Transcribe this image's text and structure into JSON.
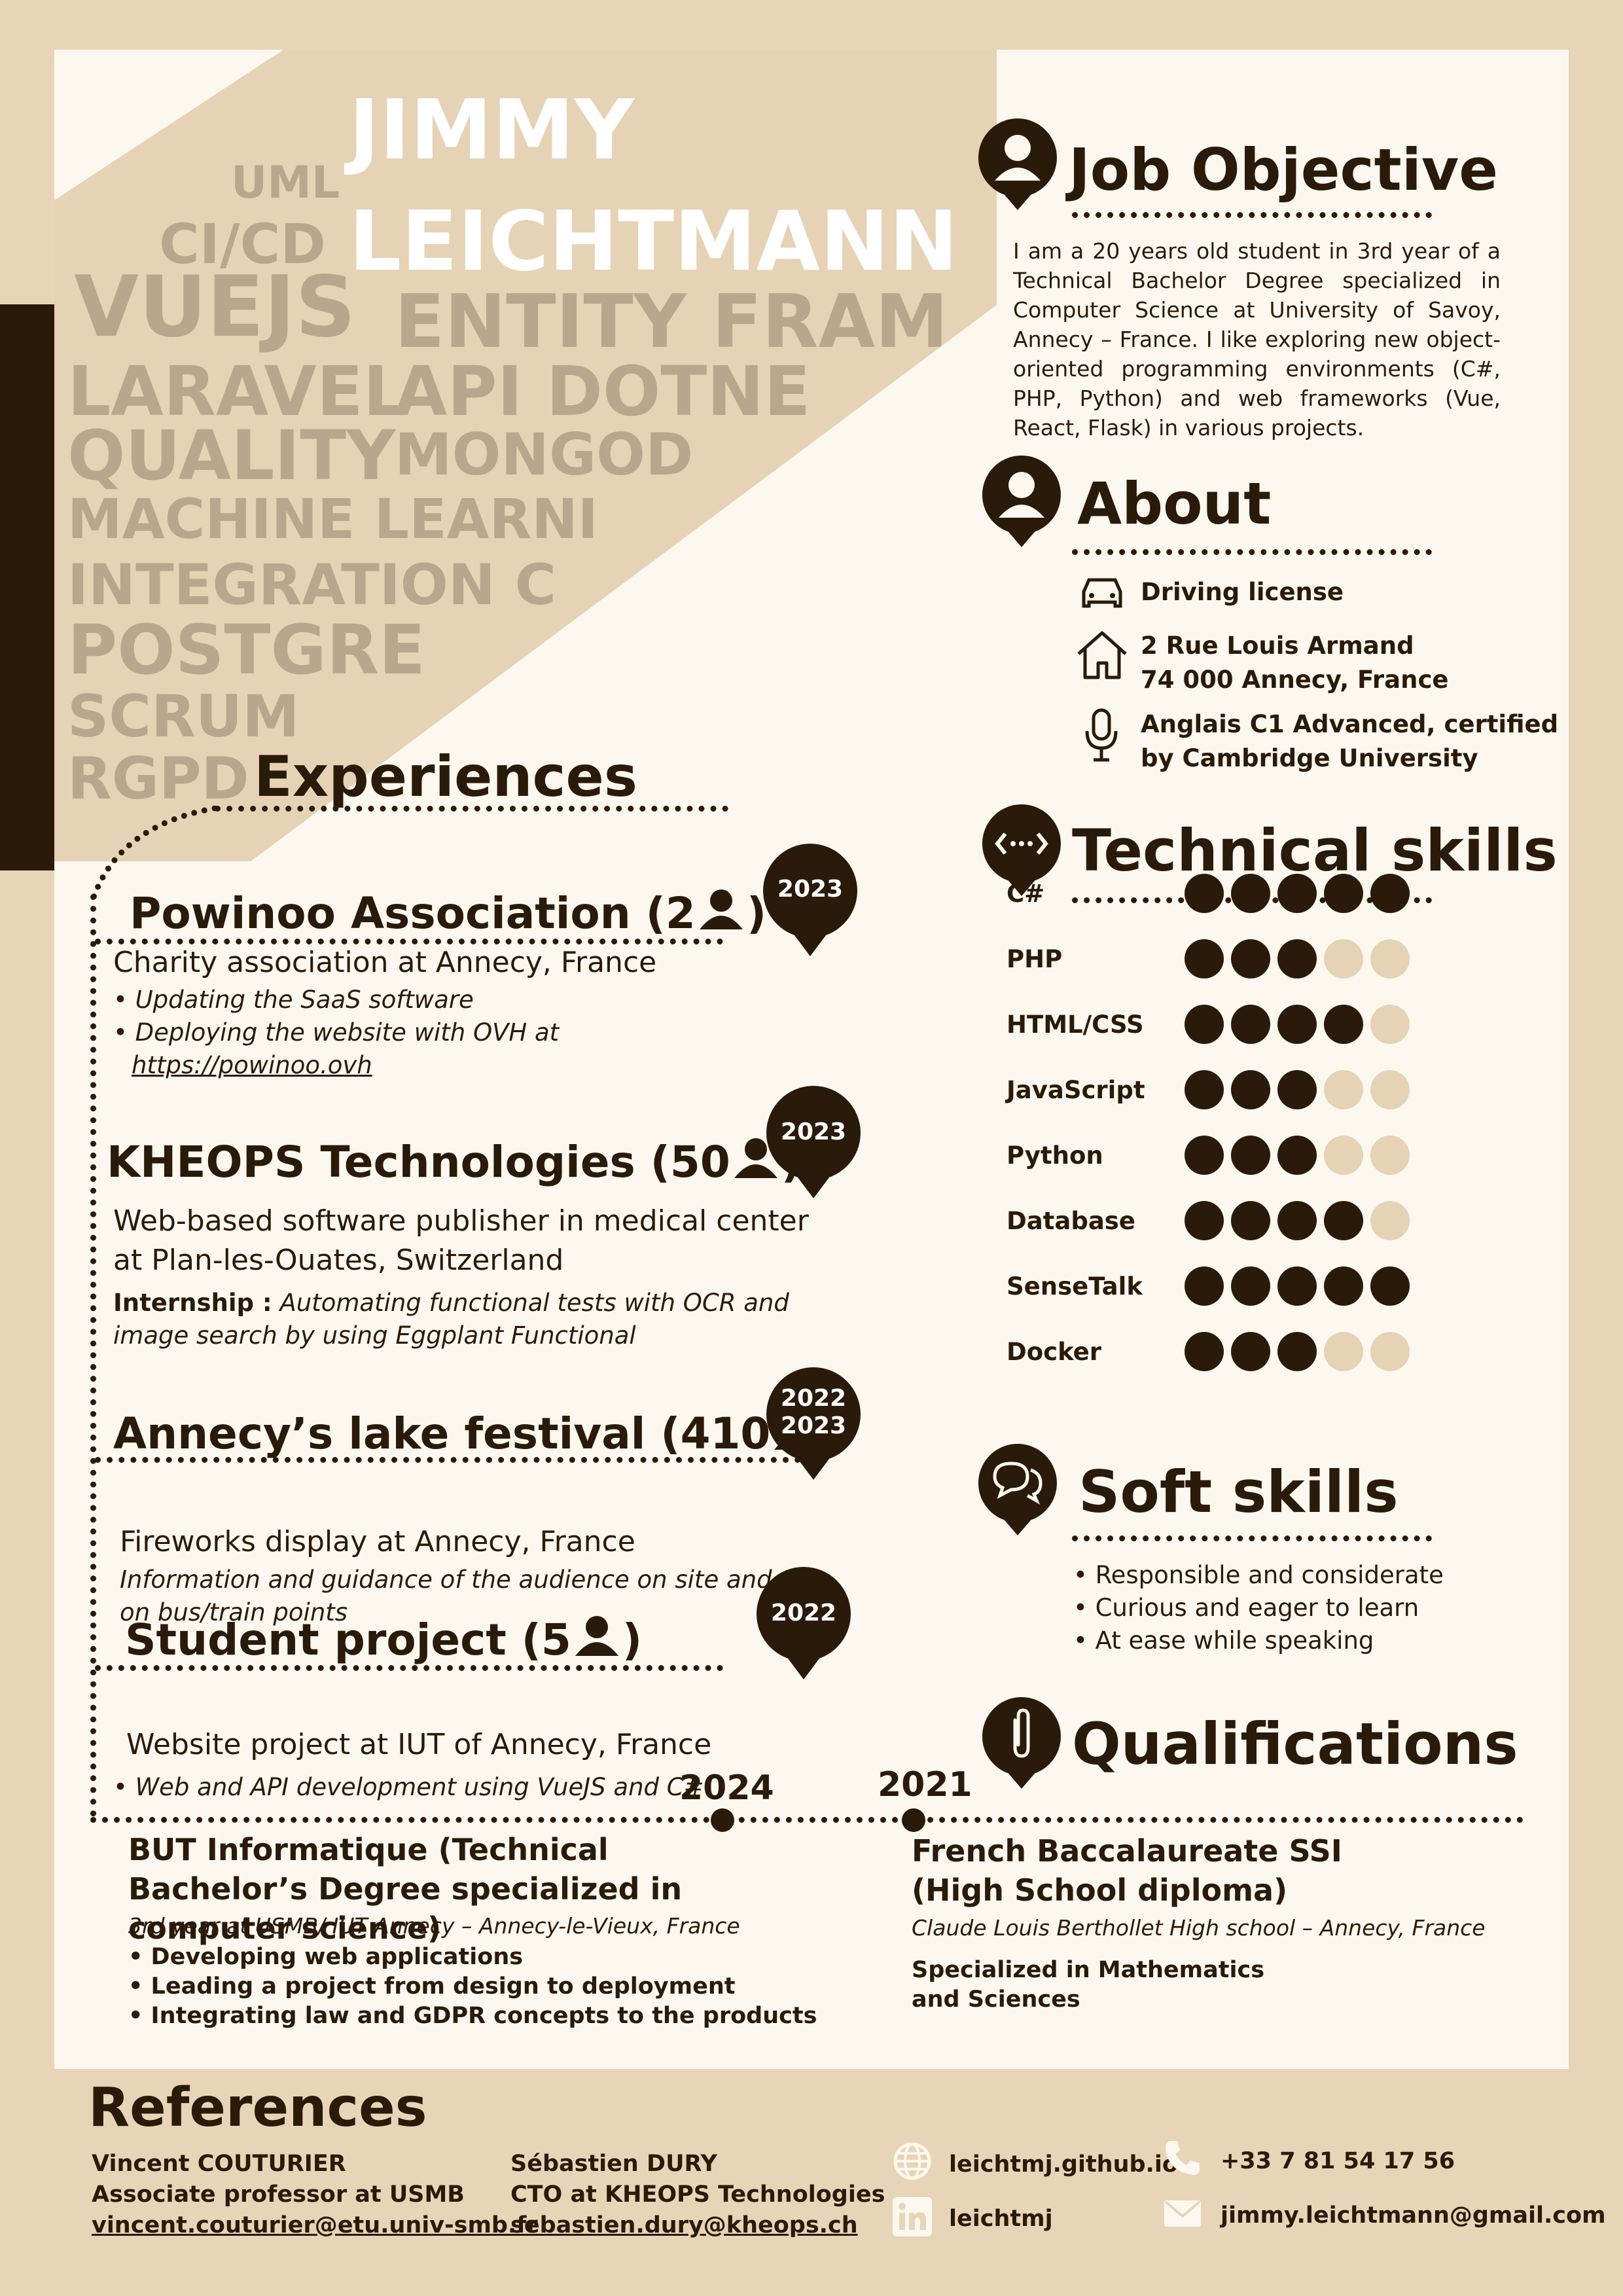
{
  "header": {
    "first_name": "JIMMY",
    "last_name": "LEICHTMANN",
    "keywords": [
      "UML",
      "CI/CD",
      "VUEJS",
      "ENTITY FRAM",
      "LARAVEL",
      "API DOTNE",
      "QUALITY",
      "MONGOD",
      "MACHINE LEARNI",
      "INTEGRATION C",
      "POSTGRE",
      "SCRUM",
      "RGPD"
    ]
  },
  "job_objective": {
    "title": "Job Objective",
    "text": "I am a 20 years old student in 3rd year of a Technical Bachelor Degree specialized in Computer Science at University of Savoy, Annecy – France. I like exploring new object-oriented programming environments (C#, PHP, Python) and web frameworks (Vue, React, Flask) in various projects."
  },
  "about": {
    "title": "About",
    "items": [
      {
        "icon": "car-icon",
        "text": "Driving license"
      },
      {
        "icon": "house-icon",
        "text": "2 Rue Louis Armand\n74 000 Annecy, France"
      },
      {
        "icon": "microphone-icon",
        "text": "Anglais C1 Advanced, certified\nby Cambridge University"
      }
    ]
  },
  "technical_skills": {
    "title": "Technical skills",
    "max_level": 5,
    "skills": [
      {
        "name": "C#",
        "level": 5
      },
      {
        "name": "PHP",
        "level": 3
      },
      {
        "name": "HTML/CSS",
        "level": 4
      },
      {
        "name": "JavaScript",
        "level": 3
      },
      {
        "name": "Python",
        "level": 3
      },
      {
        "name": "Database",
        "level": 4
      },
      {
        "name": "SenseTalk",
        "level": 5
      },
      {
        "name": "Docker",
        "level": 3
      }
    ]
  },
  "soft_skills": {
    "title": "Soft skills",
    "items": [
      "• Responsible and considerate",
      "• Curious and eager to learn",
      "• At ease while speaking"
    ]
  },
  "qualifications": {
    "title": "Qualifications",
    "years": [
      "2024",
      "2021"
    ],
    "entries": [
      {
        "title": "BUT Informatique (Technical Bachelor’s Degree specialized in computer science)",
        "place": "3rd year at USMB/ IUT Annecy – Annecy-le-Vieux, France",
        "bullets": [
          "• Developing web applications",
          "• Leading a project from design to deployment",
          "• Integrating law and GDPR concepts to the products"
        ]
      },
      {
        "title": "French Baccalaureate SSI (High School diploma)",
        "place": "Claude Louis Berthollet High school – Annecy, France",
        "note": "Specialized in Mathematics and Sciences"
      }
    ]
  },
  "experiences": {
    "title": "Experiences",
    "items": [
      {
        "title": "Powinoo Association (2",
        "title_end": ")",
        "badge": "2023",
        "subtitle": "Charity association at Annecy, France",
        "lines": [
          "• Updating the SaaS software",
          "• Deploying the website with OVH at"
        ],
        "link": "https://powinoo.ovh"
      },
      {
        "title": "KHEOPS Technologies (50",
        "title_end": ")",
        "badge": "2023",
        "subtitle": "Web-based software publisher in medical center at Plan-les-Ouates, Switzerland",
        "bold_prefix": "Internship :",
        "detail": " Automating functional tests with OCR and image search by using Eggplant Functional"
      },
      {
        "title": "Annecy’s lake festival (410",
        "title_end": ")",
        "badge": "2022\n2023",
        "subtitle": "Fireworks display at Annecy, France",
        "detail": "Information and guidance of the audience on site and on bus/train points"
      },
      {
        "title": "Student project (5",
        "title_end": ")",
        "badge": "2022",
        "subtitle": "Website project at IUT of Annecy, France",
        "detail": "• Web and API development using VueJS and C#"
      }
    ]
  },
  "references": {
    "title": "References",
    "people": [
      {
        "name": "Vincent COUTURIER",
        "role": "Associate professor at USMB",
        "email": "vincent.couturier@etu.univ-smb.fr"
      },
      {
        "name": "Sébastien DURY",
        "role": "CTO at KHEOPS Technologies",
        "email": "sebastien.dury@kheops.ch"
      }
    ]
  },
  "contact": {
    "website": "leichtmj.github.io",
    "linkedin": "leichtmj",
    "phone": "+33 7 81 54 17 56",
    "email": "jimmy.leichtmann@gmail.com"
  },
  "colors": {
    "dark": "#2A1A0A",
    "background": "#E8D5B7",
    "card": "#FDF8EF",
    "muted": "#B9A68C",
    "dot_off": "#E6D2B5"
  }
}
